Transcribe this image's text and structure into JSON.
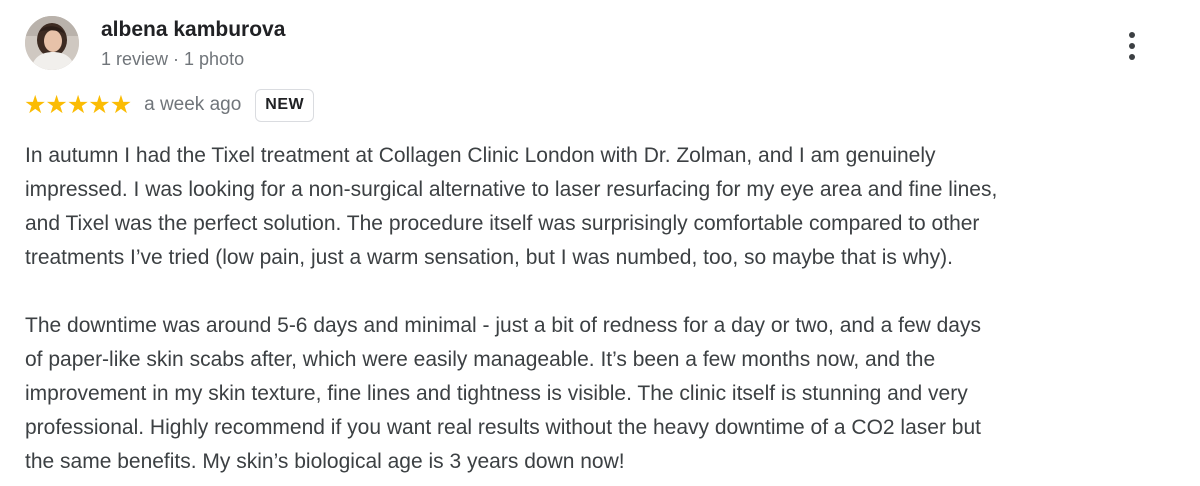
{
  "author": {
    "name": "albena kamburova",
    "meta": "1 review · 1 photo"
  },
  "rating": {
    "stars": 5,
    "max_stars": 5,
    "star_glyph": "★",
    "star_color": "#fbbc04",
    "date": "a week ago",
    "badge": "NEW"
  },
  "review": {
    "text": "In autumn I had the Tixel treatment at Collagen Clinic London with Dr. Zolman, and I am genuinely\nimpressed. I was looking for a non-surgical alternative to laser resurfacing for my eye area and fine lines,\nand Tixel was the perfect solution. The procedure itself was surprisingly comfortable compared to other\ntreatments I’ve tried (low pain, just a warm sensation, but I was numbed, too, so maybe that is why).\n\nThe downtime was around 5-6 days and minimal - just a bit of redness for a day or two, and a few days\nof paper-like skin scabs after, which were easily manageable. It’s been a few months now, and the\nimprovement in my skin texture, fine lines and tightness is visible. The clinic itself is stunning and very\nprofessional. Highly recommend if you want real results without the heavy downtime of a CO2 laser but\nthe same benefits. My skin’s biological age is 3 years down now!"
  },
  "icons": {
    "more": "more-vertical-icon",
    "avatar": "avatar-photo"
  }
}
